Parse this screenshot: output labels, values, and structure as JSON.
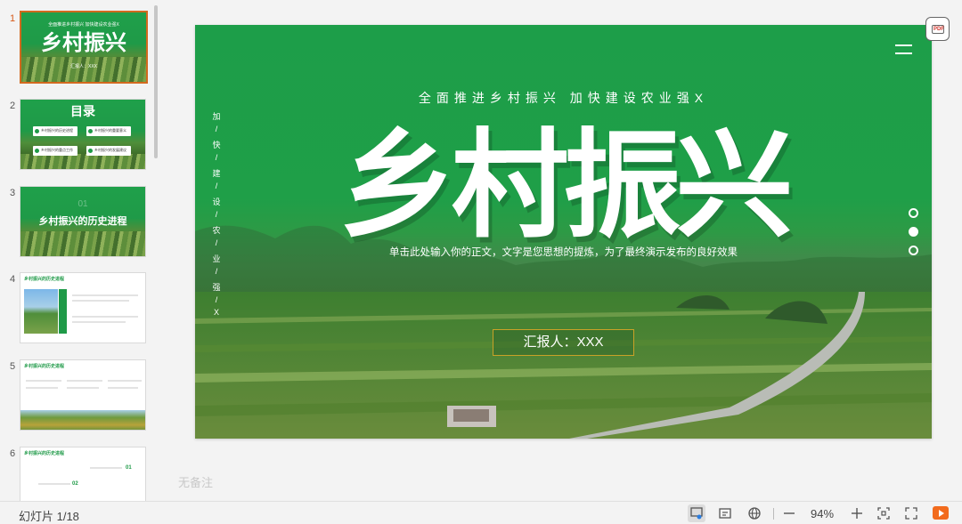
{
  "thumbnails": [
    {
      "number": "1",
      "title": "乡村振兴",
      "subtitle": "全面推进乡村振兴 加快建设农业强X",
      "reporter": "汇报人：XXX"
    },
    {
      "number": "2",
      "title": "目录",
      "items": [
        "乡村振兴的历史进程",
        "乡村振兴的重要意义",
        "乡村振兴的重点工作",
        "乡村振兴的发展建议"
      ]
    },
    {
      "number": "3",
      "title": "乡村振兴的历史进程",
      "caption": "01"
    },
    {
      "number": "4",
      "heading": "乡村振兴的历史进程"
    },
    {
      "number": "5",
      "heading": "乡村振兴的历史进程"
    },
    {
      "number": "6",
      "heading": "乡村振兴的历史进程",
      "labels": [
        "01",
        "02"
      ]
    }
  ],
  "slide": {
    "vertical_text": [
      "加",
      "/",
      "快",
      "/",
      "建",
      "/",
      "设",
      "/",
      "农",
      "/",
      "业",
      "/",
      "强",
      "/",
      "X"
    ],
    "subtitle": "全面推进乡村振兴 加快建设农业强X",
    "title": "乡村振兴",
    "tagline": "单击此处输入你的正文，文字是您思想的提炼，为了最终演示发布的良好效果",
    "reporter": "汇报人：XXX"
  },
  "notes_placeholder": "无备注",
  "status": {
    "slide_count": "幻灯片 1/18",
    "zoom": "94%"
  },
  "icons": {
    "pdf": "pdf-export-icon",
    "notes": "notes-view-icon",
    "comment": "comment-icon",
    "language": "globe-icon",
    "zoom_out": "minus-icon",
    "zoom_in": "plus-icon",
    "fit": "fit-screen-icon",
    "fullscreen": "fullscreen-icon",
    "play": "play-icon"
  },
  "colors": {
    "brand_green": "#1f9a48",
    "accent_orange": "#f26b1d",
    "reporter_border": "#c9a227"
  }
}
